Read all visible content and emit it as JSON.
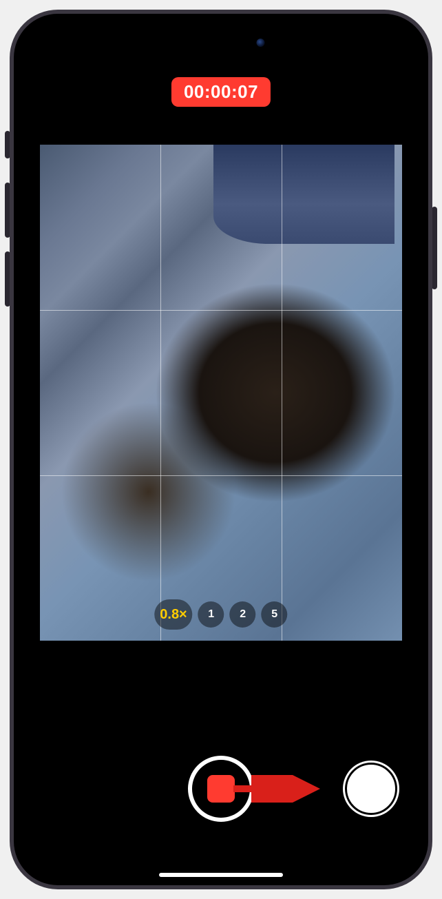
{
  "timer": {
    "elapsed": "00:00:07"
  },
  "zoom": {
    "selected": "0.8×",
    "options": [
      "1",
      "2",
      "5"
    ]
  },
  "colors": {
    "record_red": "#ff3b30",
    "zoom_selected": "#ffcc00"
  },
  "controls": {
    "record_button": "stop-recording",
    "photo_button": "capture-photo"
  }
}
